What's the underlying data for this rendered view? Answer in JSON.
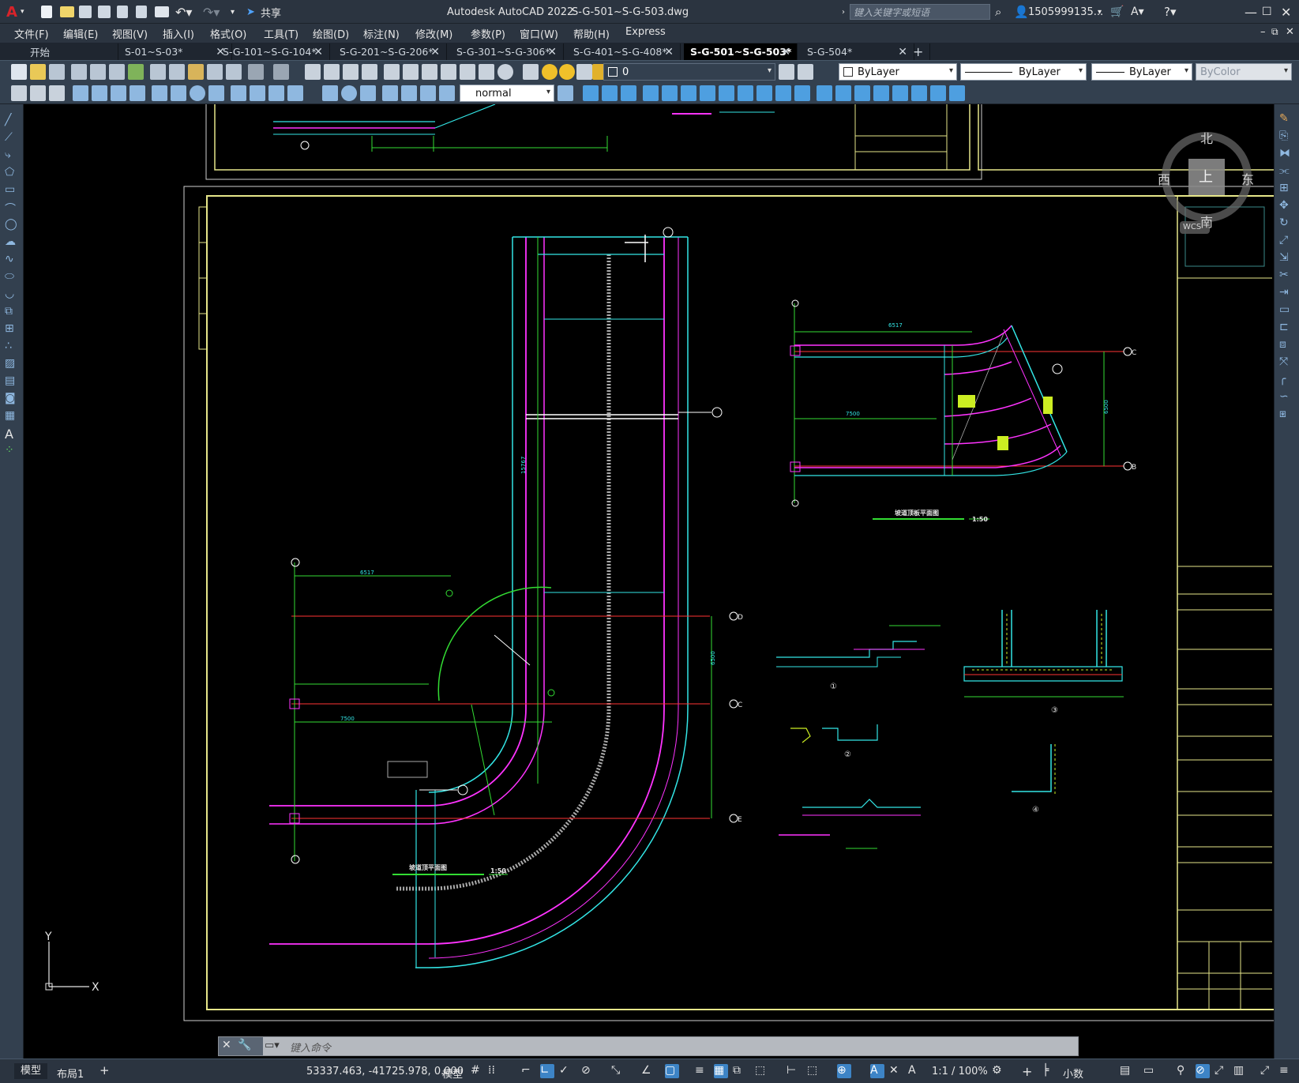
{
  "app": {
    "title": "Autodesk AutoCAD 2022",
    "filename": "S-G-501~S-G-503.dwg",
    "share": "共享",
    "search_placeholder": "键入关键字或短语",
    "user": "1505999135...",
    "logo": "A"
  },
  "menu": [
    "文件(F)",
    "编辑(E)",
    "视图(V)",
    "插入(I)",
    "格式(O)",
    "工具(T)",
    "绘图(D)",
    "标注(N)",
    "修改(M)",
    "参数(P)",
    "窗口(W)",
    "帮助(H)",
    "Express"
  ],
  "tabs": [
    {
      "label": "开始",
      "active": false,
      "closable": false
    },
    {
      "label": "S-01~S-03*",
      "active": false,
      "closable": true
    },
    {
      "label": "S-G-101~S-G-104*",
      "active": false,
      "closable": true
    },
    {
      "label": "S-G-201~S-G-206*",
      "active": false,
      "closable": true
    },
    {
      "label": "S-G-301~S-G-306*",
      "active": false,
      "closable": true
    },
    {
      "label": "S-G-401~S-G-408*",
      "active": false,
      "closable": true
    },
    {
      "label": "S-G-501~S-G-503*",
      "active": true,
      "closable": true
    },
    {
      "label": "S-G-504*",
      "active": false,
      "closable": true
    }
  ],
  "toolbar": {
    "layer": "0",
    "linetype_color": "ByLayer",
    "linetype": "ByLayer",
    "lineweight": "ByLayer",
    "plotstyle": "ByColor",
    "textstyle": "normal"
  },
  "viewcube": {
    "north": "北",
    "south": "南",
    "east": "东",
    "west": "西",
    "top": "上",
    "wcs": "WCS"
  },
  "drawing": {
    "plan_title": "坡道顶平面图",
    "plan_scale": "1:50",
    "slab_title": "坡道顶板平面图",
    "slab_scale": "1:50",
    "detail_labels": [
      "①",
      "②",
      "③",
      "④"
    ],
    "axes": [
      "C",
      "D",
      "E",
      "B"
    ],
    "dims": [
      "6517",
      "7500",
      "6500",
      "5000",
      "15767"
    ]
  },
  "ucs": {
    "x": "X",
    "y": "Y"
  },
  "cmdline": {
    "placeholder": "键入命令"
  },
  "layout_tabs": [
    "模型",
    "布局1"
  ],
  "status": {
    "coords": "53337.463, -41725.978, 0.000",
    "space": "模型",
    "scale": "1:1 / 100%",
    "units": "小数"
  }
}
